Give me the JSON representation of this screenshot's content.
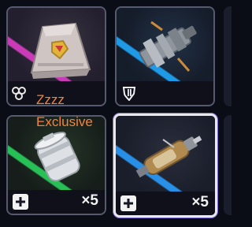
{
  "slots": [
    {
      "item": "supply-crate",
      "rarity_color": "#d23cbe",
      "badge_icon": "link-cluster-icon",
      "quantity": ""
    },
    {
      "item": "weapon-mod",
      "rarity_color": "#1ea0f0",
      "badge_icon": "shield-emblem-icon",
      "quantity": ""
    },
    {
      "item": "medical-canister",
      "rarity_color": "#28c85a",
      "badge_icon": "plus-icon",
      "quantity": "×5"
    },
    {
      "item": "stim-injector",
      "rarity_color": "#2896f0",
      "badge_icon": "plus-icon",
      "quantity": "×5"
    }
  ],
  "overlay": {
    "line1": "Zzzz",
    "line2": "Exclusive"
  }
}
